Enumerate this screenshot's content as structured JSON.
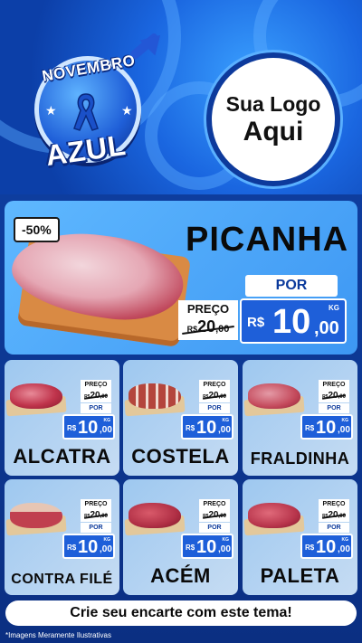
{
  "header": {
    "badge_top": "NOVEMBRO",
    "badge_bottom": "AZUL",
    "logo_line1": "Sua Logo",
    "logo_line2": "Aqui"
  },
  "featured": {
    "discount": "-50%",
    "name": "PICANHA",
    "preco_label": "PREÇO",
    "por_label": "POR",
    "old_currency": "R$",
    "old_int": "20",
    "old_dec": ",00",
    "new_currency": "R$",
    "new_int": "10",
    "new_dec": ",00",
    "unit": "KG"
  },
  "labels": {
    "preco": "PREÇO",
    "por": "POR",
    "currency": "R$",
    "unit": "KG"
  },
  "products": [
    {
      "name": "ALCATRA",
      "old_int": "20",
      "old_dec": ",00",
      "new_int": "10",
      "new_dec": ",00"
    },
    {
      "name": "COSTELA",
      "old_int": "20",
      "old_dec": ",00",
      "new_int": "10",
      "new_dec": ",00"
    },
    {
      "name": "FRALDINHA",
      "old_int": "20",
      "old_dec": ",00",
      "new_int": "10",
      "new_dec": ",00"
    },
    {
      "name": "CONTRA FILÉ",
      "old_int": "20",
      "old_dec": ",00",
      "new_int": "10",
      "new_dec": ",00"
    },
    {
      "name": "ACÉM",
      "old_int": "20",
      "old_dec": ",00",
      "new_int": "10",
      "new_dec": ",00"
    },
    {
      "name": "PALETA",
      "old_int": "20",
      "old_dec": ",00",
      "new_int": "10",
      "new_dec": ",00"
    }
  ],
  "footer": {
    "cta": "Crie seu encarte com este tema!",
    "disclaimer": "*Imagens Meramente Ilustrativas"
  },
  "colors": {
    "brand_blue": "#1e5fd9",
    "dark_blue": "#0d3a9c",
    "light_blue": "#5fb8ff"
  }
}
